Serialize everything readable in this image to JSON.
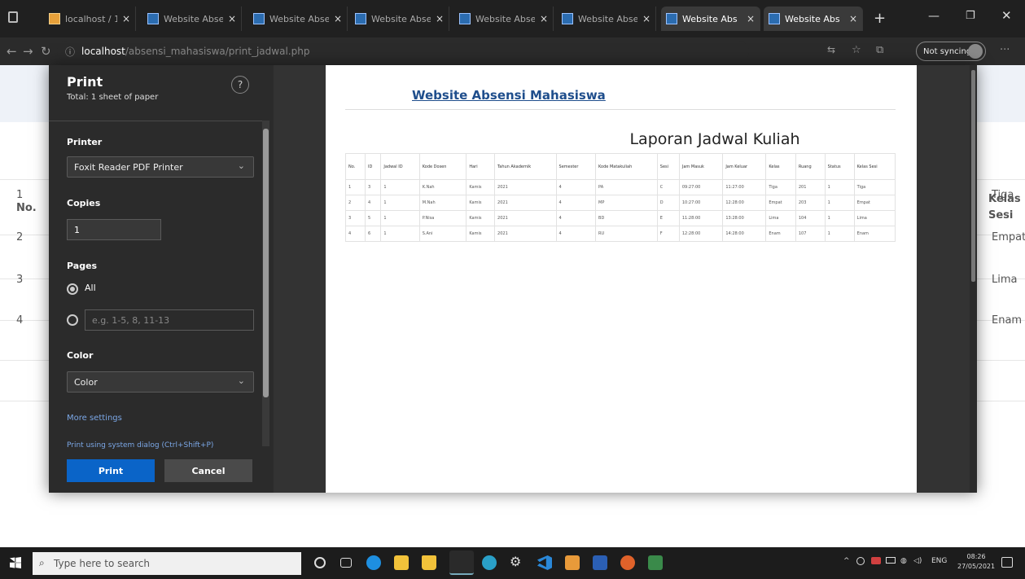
{
  "browser": {
    "tabs": [
      {
        "label": "localhost / 1",
        "favicon": "phpmyadmin-icon"
      },
      {
        "label": "Website Absen",
        "favicon": "page-icon"
      },
      {
        "label": "Website Absen",
        "favicon": "page-icon"
      },
      {
        "label": "Website Absen",
        "favicon": "page-icon"
      },
      {
        "label": "Website Absen",
        "favicon": "page-icon"
      },
      {
        "label": "Website Absen",
        "favicon": "page-icon"
      },
      {
        "label": "Website Abs",
        "favicon": "page-icon"
      },
      {
        "label": "Website Abs",
        "favicon": "page-icon"
      }
    ],
    "new_tab": "+",
    "url_host": "localhost",
    "url_path": "/absensi_mahasiswa/print_jadwal.php",
    "sync_label": "Not syncing"
  },
  "background_page": {
    "header_no": "No.",
    "header_right": "Kelas\nSesi",
    "rows": [
      {
        "no": "1",
        "right": "Tiga"
      },
      {
        "no": "2",
        "right": "Empat"
      },
      {
        "no": "3",
        "right": "Lima"
      },
      {
        "no": "4",
        "right": "Enam"
      }
    ]
  },
  "print_dialog": {
    "title": "Print",
    "subtitle": "Total: 1 sheet of paper",
    "help": "?",
    "printer_label": "Printer",
    "printer_value": "Foxit Reader PDF Printer",
    "copies_label": "Copies",
    "copies_value": "1",
    "pages_label": "Pages",
    "pages_all": "All",
    "pages_range_placeholder": "e.g. 1-5, 8, 11-13",
    "color_label": "Color",
    "color_value": "Color",
    "more_settings": "More settings",
    "system_dialog": "Print using system dialog (Ctrl+Shift+P)",
    "print_button": "Print",
    "cancel_button": "Cancel"
  },
  "preview": {
    "site_title": "Website Absensi Mahasiswa",
    "report_title": "Laporan Jadwal Kuliah",
    "columns": [
      "No.",
      "ID",
      "Jadwal ID",
      "Kode Dosen",
      "Hari",
      "Tahun Akademik",
      "Semester",
      "Kode Matakuliah",
      "Sesi",
      "Jam Masuk",
      "Jam Keluar",
      "Kelas",
      "Ruang",
      "Status",
      "Kelas Sesi"
    ],
    "rows": [
      [
        "1",
        "3",
        "1",
        "K.Nah",
        "Kamis",
        "2021",
        "4",
        "PA",
        "C",
        "09:27:00",
        "11:27:00",
        "Tiga",
        "201",
        "1",
        "Tiga"
      ],
      [
        "2",
        "4",
        "1",
        "M.Nah",
        "Kamis",
        "2021",
        "4",
        "MP",
        "D",
        "10:27:00",
        "12:28:00",
        "Empat",
        "203",
        "1",
        "Empat"
      ],
      [
        "3",
        "5",
        "1",
        "P.Nisa",
        "Kamis",
        "2021",
        "4",
        "BD",
        "E",
        "11:28:00",
        "13:28:00",
        "Lima",
        "104",
        "1",
        "Lima"
      ],
      [
        "4",
        "6",
        "1",
        "S.Ani",
        "Kamis",
        "2021",
        "4",
        "RU",
        "F",
        "12:28:00",
        "14:28:00",
        "Enam",
        "107",
        "1",
        "Enam"
      ]
    ]
  },
  "taskbar": {
    "search_placeholder": "Type here to search",
    "lang": "ENG",
    "time": "08:26",
    "date": "27/05/2021"
  }
}
